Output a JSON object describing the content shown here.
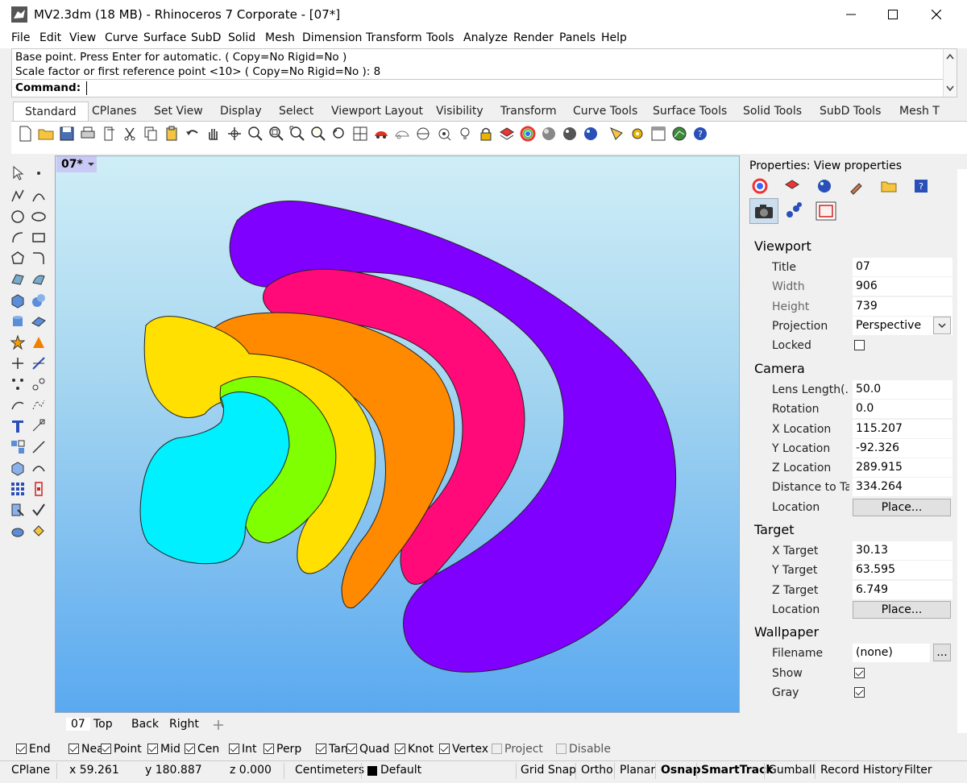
{
  "window": {
    "title": "MV2.3dm (18 MB) - Rhinoceros 7 Corporate - [07*]"
  },
  "menu": [
    "File",
    "Edit",
    "View",
    "Curve",
    "Surface",
    "SubD",
    "Solid",
    "Mesh",
    "Dimension",
    "Transform",
    "Tools",
    "Analyze",
    "Render",
    "Panels",
    "Help"
  ],
  "command": {
    "line1": "Base point. Press Enter for automatic. ( Copy=No  Rigid=No )",
    "line2": "Scale factor or first reference point <10> ( Copy=No  Rigid=No ): 8",
    "label": "Command:"
  },
  "toolbar_tabs": [
    "Standard",
    "CPlanes",
    "Set View",
    "Display",
    "Select",
    "Viewport Layout",
    "Visibility",
    "Transform",
    "Curve Tools",
    "Surface Tools",
    "Solid Tools",
    "SubD Tools",
    "Mesh T"
  ],
  "viewport": {
    "label": "07*",
    "tabs": [
      "07",
      "Top",
      "Back",
      "Right"
    ]
  },
  "properties": {
    "title": "Properties: View properties",
    "viewport_heading": "Viewport",
    "title_label": "Title",
    "title_value": "07",
    "width_label": "Width",
    "width_value": "906",
    "height_label": "Height",
    "height_value": "739",
    "projection_label": "Projection",
    "projection_value": "Perspective",
    "locked_label": "Locked",
    "locked": false,
    "camera_heading": "Camera",
    "lens_label": "Lens Length(...",
    "lens_value": "50.0",
    "rotation_label": "Rotation",
    "rotation_value": "0.0",
    "xloc_label": "X Location",
    "xloc_value": "115.207",
    "yloc_label": "Y Location",
    "yloc_value": "-92.326",
    "zloc_label": "Z Location",
    "zloc_value": "289.915",
    "dist_label": "Distance to Ta...",
    "dist_value": "334.264",
    "camloc_label": "Location",
    "place_label": "Place...",
    "target_heading": "Target",
    "xt_label": "X Target",
    "xt_value": "30.13",
    "yt_label": "Y Target",
    "yt_value": "63.595",
    "zt_label": "Z Target",
    "zt_value": "6.749",
    "tloc_label": "Location",
    "wallpaper_heading": "Wallpaper",
    "filename_label": "Filename",
    "filename_value": "(none)",
    "browse_label": "...",
    "show_label": "Show",
    "show": true,
    "gray_label": "Gray",
    "gray": true
  },
  "osnap": {
    "end": "End",
    "near": "Near",
    "point": "Point",
    "mid": "Mid",
    "cen": "Cen",
    "int": "Int",
    "perp": "Perp",
    "tan": "Tan",
    "quad": "Quad",
    "knot": "Knot",
    "vertex": "Vertex",
    "project": "Project",
    "disable": "Disable"
  },
  "status": {
    "cplane": "CPlane",
    "x": "x 59.261",
    "y": "y 180.887",
    "z": "z 0.000",
    "units": "Centimeters",
    "layer": "Default",
    "grid_snap": "Grid Snap",
    "ortho": "Ortho",
    "planar": "Planar",
    "osnap": "Osnap",
    "smarttrack": "SmartTrack",
    "gumball": "Gumball",
    "record_history": "Record History",
    "filter": "Filter"
  },
  "colors": {
    "purple": "#8000ff",
    "pink": "#ff0a78",
    "orange": "#ff8a00",
    "yellow": "#ffe000",
    "green": "#80ff00",
    "cyan": "#00f0ff",
    "viewport_label_bg": "#c9c9f5"
  }
}
